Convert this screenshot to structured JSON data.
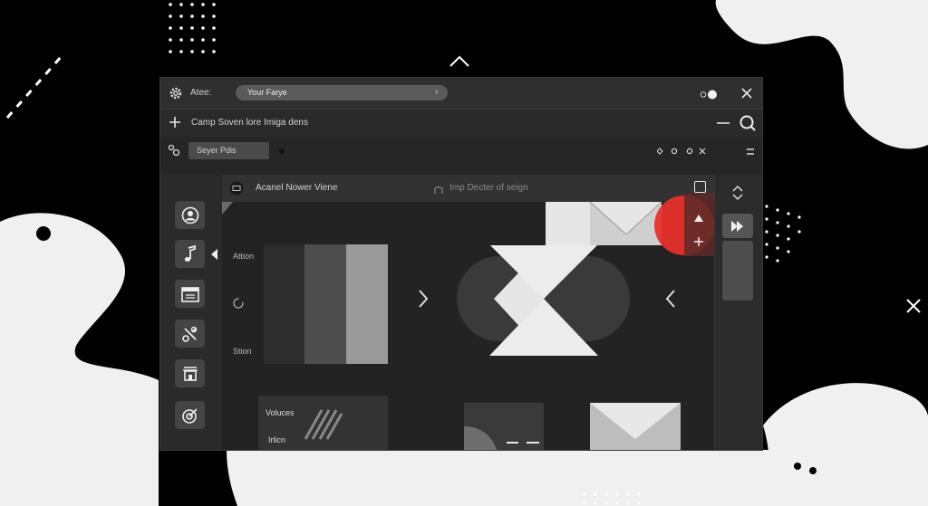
{
  "titlebar": {
    "app_title": "Atee:",
    "address_value": "Your Farye"
  },
  "toolbar": {
    "label": "Camp Soven lore Imiga dens"
  },
  "subbar": {
    "chip_label": "Seyer Pdis"
  },
  "tabs": {
    "active_label": "Acanel Nower Viene",
    "second_label": "Imp Decter of seign"
  },
  "canvas": {
    "label_top": "Attion",
    "label_bottom": "Stion",
    "card_label_1": "Voluces",
    "card_label_2": "Irlicn"
  },
  "colors": {
    "accent_red": "#e8302a",
    "window_bg": "#2b2b2b"
  },
  "icons": {
    "settings": "gear-icon",
    "add": "plus-icon",
    "search": "search-icon",
    "close": "close-icon",
    "sidebar": [
      "user-icon",
      "music-note-icon",
      "calendar-icon",
      "tools-icon",
      "building-icon",
      "target-icon"
    ],
    "right_panel": [
      "chevron-up-down-icon",
      "fast-forward-icon"
    ]
  }
}
